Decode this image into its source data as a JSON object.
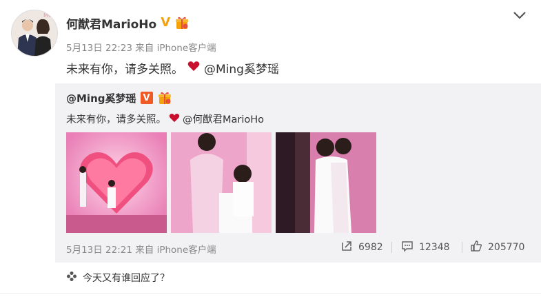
{
  "post": {
    "author": "何猷君MarioHo",
    "verified_mark": "V",
    "time": "5月13日 22:23",
    "source_prefix": "来自",
    "source": "iPhone客户端",
    "text": "未来有你，请多关照。",
    "mention": "@Ming奚梦瑶"
  },
  "repost": {
    "author": "@Ming奚梦瑶",
    "verified_mark": "V",
    "text": "未来有你，请多关照。",
    "mention": "@何猷君MarioHo",
    "time": "5月13日 22:21",
    "source_prefix": "来自",
    "source": "iPhone客户端",
    "stats": {
      "reposts": "6982",
      "comments": "12348",
      "likes": "205770"
    }
  },
  "footer": {
    "text": "今天又有谁回应了？"
  },
  "icons": {
    "more": "chevron-down-icon",
    "repost": "repost-icon",
    "comment": "comment-icon",
    "like": "thumbs-up-icon"
  },
  "colors": {
    "verified_gold": "#f5a20a",
    "verified_orange": "#f15a24",
    "heart": "#c8102e",
    "repost_bg": "#f2f2f5"
  }
}
